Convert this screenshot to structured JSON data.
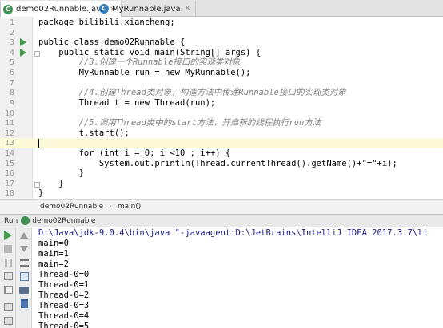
{
  "tabs": [
    {
      "label": "demo02Runnable.java",
      "active": true,
      "icon": "run-class-icon"
    },
    {
      "label": "MyRunnable.java",
      "active": false,
      "icon": "class-icon"
    }
  ],
  "editor": {
    "current_line": 13,
    "lines": [
      {
        "n": "1",
        "text": "package bilibili.xiancheng;"
      },
      {
        "n": "2",
        "text": ""
      },
      {
        "n": "3",
        "text": "public class demo02Runnable {"
      },
      {
        "n": "4",
        "text": "    public static void main(String[] args) {"
      },
      {
        "n": "5",
        "text": "        //3.创建一个Runnable接口的实现类对象"
      },
      {
        "n": "6",
        "text": "        MyRunnable run = new MyRunnable();"
      },
      {
        "n": "7",
        "text": ""
      },
      {
        "n": "8",
        "text": "        //4.创建Thread类对象，构造方法中传递Runnable接口的实现类对象"
      },
      {
        "n": "9",
        "text": "        Thread t = new Thread(run);"
      },
      {
        "n": "10",
        "text": ""
      },
      {
        "n": "11",
        "text": "        //5.调用Thread类中的start方法，开启新的线程执行run方法"
      },
      {
        "n": "12",
        "text": "        t.start();"
      },
      {
        "n": "13",
        "text": ""
      },
      {
        "n": "14",
        "text": "        for (int i = 0; i <10 ; i++) {"
      },
      {
        "n": "15",
        "text": "            System.out.println(Thread.currentThread().getName()+\"=\"+i);"
      },
      {
        "n": "16",
        "text": "        }"
      },
      {
        "n": "17",
        "text": "    }"
      },
      {
        "n": "18",
        "text": "}"
      },
      {
        "n": "19",
        "text": ""
      }
    ]
  },
  "breadcrumb": {
    "class_name": "demo02Runnable",
    "method": "main()"
  },
  "run_panel": {
    "label": "Run",
    "config_name": "demo02Runnable",
    "output": [
      "D:\\Java\\jdk-9.0.4\\bin\\java \"-javaagent:D:\\JetBrains\\IntelliJ IDEA 2017.3.7\\li",
      "main=0",
      "main=1",
      "main=2",
      "Thread-0=0",
      "Thread-0=1",
      "Thread-0=2",
      "Thread-0=3",
      "Thread-0=4",
      "Thread-0=5"
    ]
  },
  "colors": {
    "keyword": "#000080",
    "comment": "#808080",
    "number": "#0000ff",
    "string": "#008000",
    "field": "#660e7a",
    "run_green": "#3f9b46",
    "current_line": "#fcfad8"
  }
}
